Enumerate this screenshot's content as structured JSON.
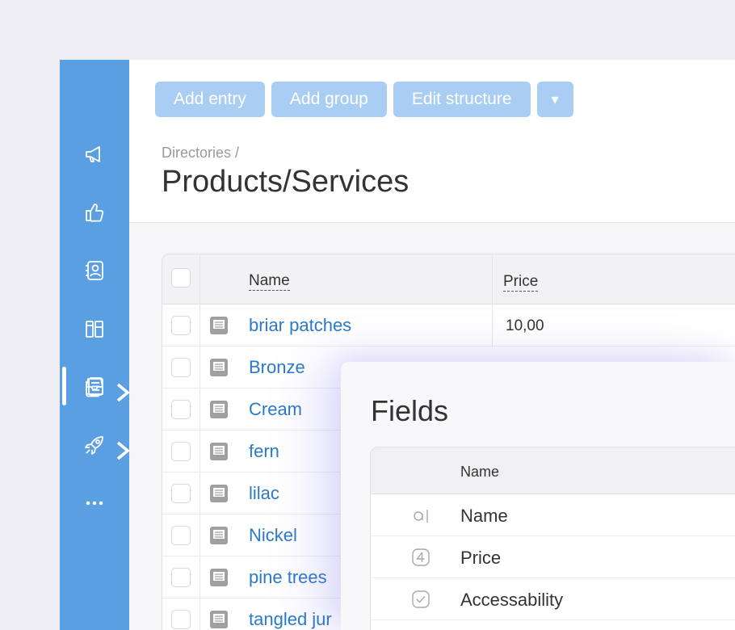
{
  "sidebar": {
    "items": [
      {
        "icon": "megaphone-icon"
      },
      {
        "icon": "thumbs-up-icon"
      },
      {
        "icon": "contact-card-icon"
      },
      {
        "icon": "book-columns-icon"
      },
      {
        "icon": "inbox-tray-icon",
        "has_submenu": true
      },
      {
        "icon": "list-document-icon",
        "active": true
      },
      {
        "icon": "rocket-icon",
        "has_submenu": true
      },
      {
        "icon": "more-dots-icon"
      }
    ]
  },
  "toolbar": {
    "add_entry": "Add entry",
    "add_group": "Add group",
    "edit_structure": "Edit structure",
    "more": "▾"
  },
  "header": {
    "breadcrumb": "Directories /",
    "title": "Products/Services"
  },
  "table": {
    "columns": [
      "Name",
      "Price"
    ],
    "rows": [
      {
        "name": "briar patches",
        "price": "10,00"
      },
      {
        "name": "Bronze",
        "price": ""
      },
      {
        "name": "Cream",
        "price": ""
      },
      {
        "name": "fern",
        "price": ""
      },
      {
        "name": "lilac",
        "price": ""
      },
      {
        "name": "Nickel",
        "price": ""
      },
      {
        "name": "pine trees",
        "price": ""
      },
      {
        "name": "tangled jur",
        "price": ""
      }
    ]
  },
  "fields_modal": {
    "title": "Fields",
    "column": "Name",
    "rows": [
      {
        "icon": "text-field-icon",
        "name": "Name"
      },
      {
        "icon": "number-field-icon",
        "name": "Price"
      },
      {
        "icon": "checkbox-field-icon",
        "name": "Accessability"
      }
    ]
  },
  "colors": {
    "sidebar": "#5b9fe3",
    "button": "#a9cdf3",
    "link": "#2a7ac8"
  }
}
